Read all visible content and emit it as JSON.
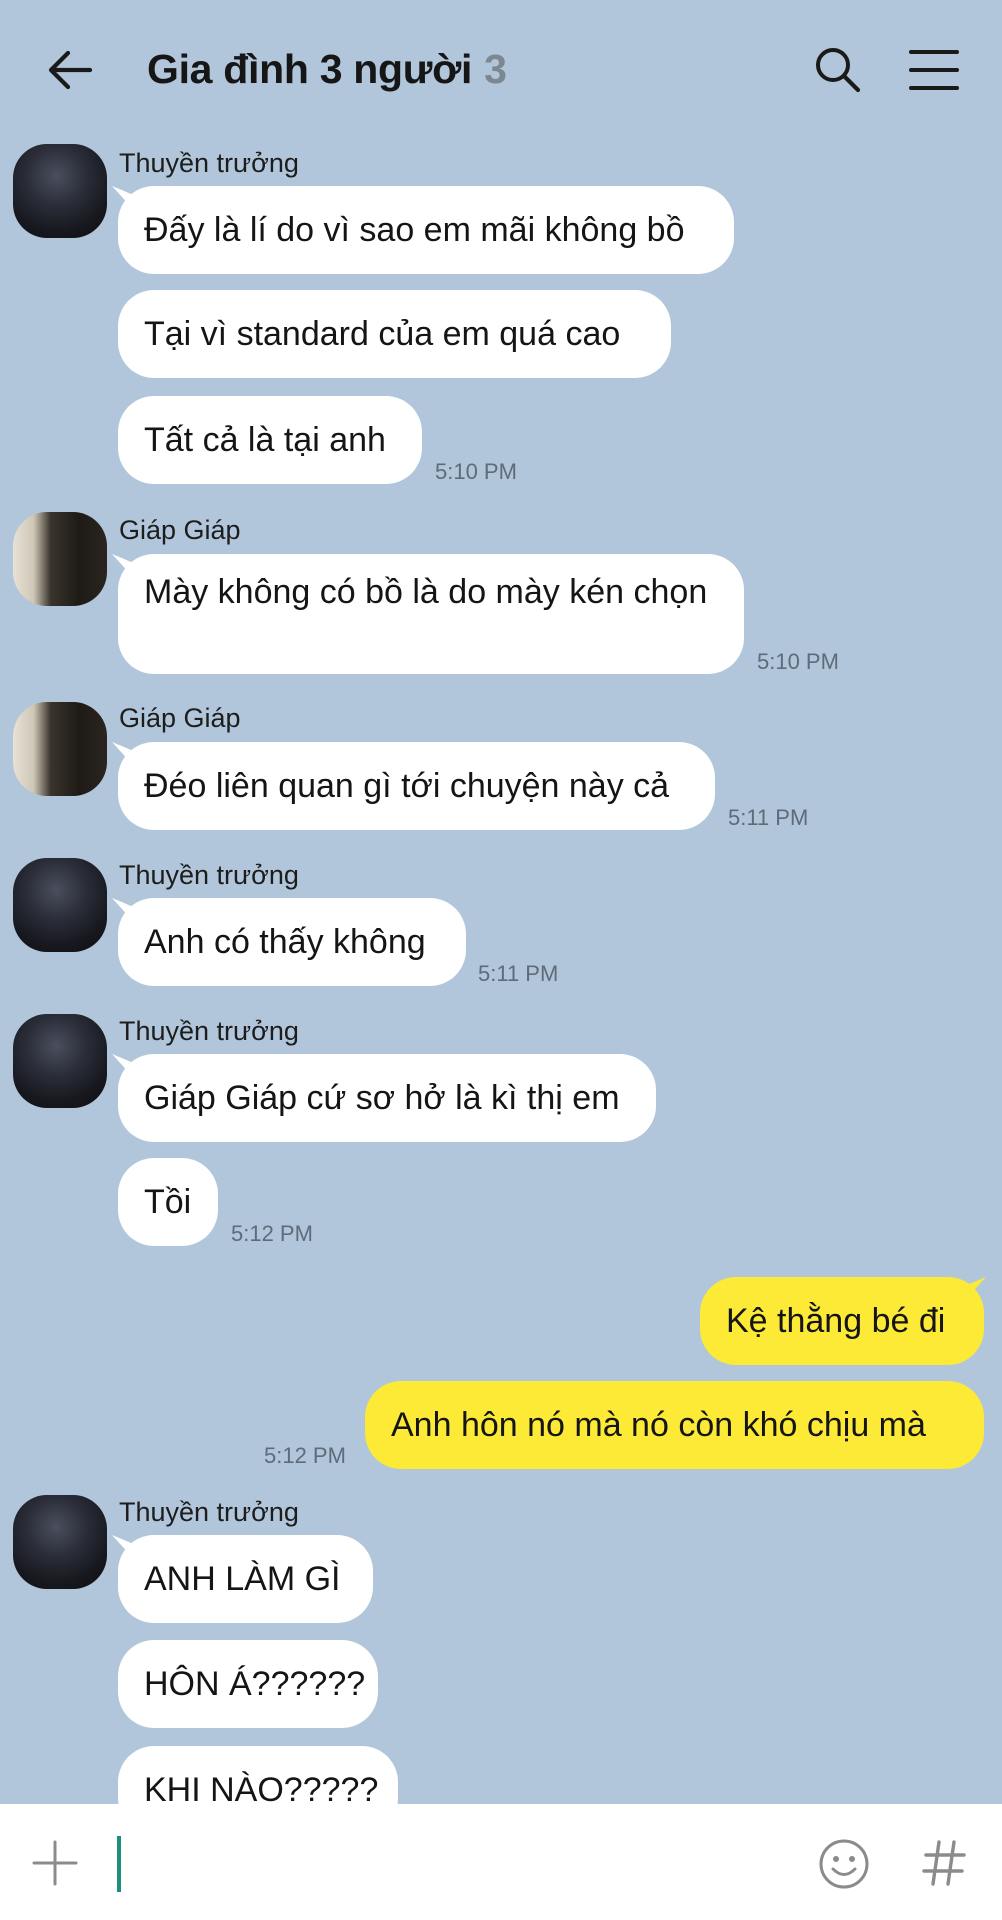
{
  "header": {
    "title": "Gia đình 3 người",
    "member_count": "3",
    "back_icon": "arrow-left-icon",
    "search_icon": "search-icon",
    "menu_icon": "hamburger-menu-icon"
  },
  "messages": [
    {
      "sender": "Thuyền trưởng",
      "lines": [
        "Đấy là lí do vì sao em mãi không bồ",
        "Tại vì standard của em quá cao",
        "Tất cả là tại anh"
      ],
      "time": "5:10 PM"
    },
    {
      "sender": "Giáp Giáp",
      "lines": [
        "Mày không có bồ là do mày kén chọn"
      ],
      "time": "5:10 PM"
    },
    {
      "sender": "Giáp Giáp",
      "lines": [
        "Đéo liên quan gì tới chuyện này cả"
      ],
      "time": "5:11 PM"
    },
    {
      "sender": "Thuyền trưởng",
      "lines": [
        "Anh có thấy không"
      ],
      "time": "5:11 PM"
    },
    {
      "sender": "Thuyền trưởng",
      "lines": [
        "Giáp Giáp cứ sơ hở là kì thị em",
        "Tồi"
      ],
      "time": "5:12 PM"
    },
    {
      "sender": "me",
      "lines": [
        "Kệ thằng bé đi",
        "Anh hôn nó mà nó còn khó chịu mà"
      ],
      "time": "5:12 PM"
    },
    {
      "sender": "Thuyền trưởng",
      "lines": [
        "ANH LÀM GÌ",
        "HÔN Á??????",
        "KHI NÀO?????"
      ],
      "time": ""
    }
  ],
  "input_bar": {
    "plus_icon": "plus-icon",
    "emoji_icon": "emoji-icon",
    "hash_icon": "hashtag-icon"
  },
  "colors": {
    "background": "#b1c6da",
    "incoming_bubble": "#ffffff",
    "outgoing_bubble": "#fcea37",
    "timestamp": "#5f6b78",
    "cursor": "#1e8f7d"
  }
}
